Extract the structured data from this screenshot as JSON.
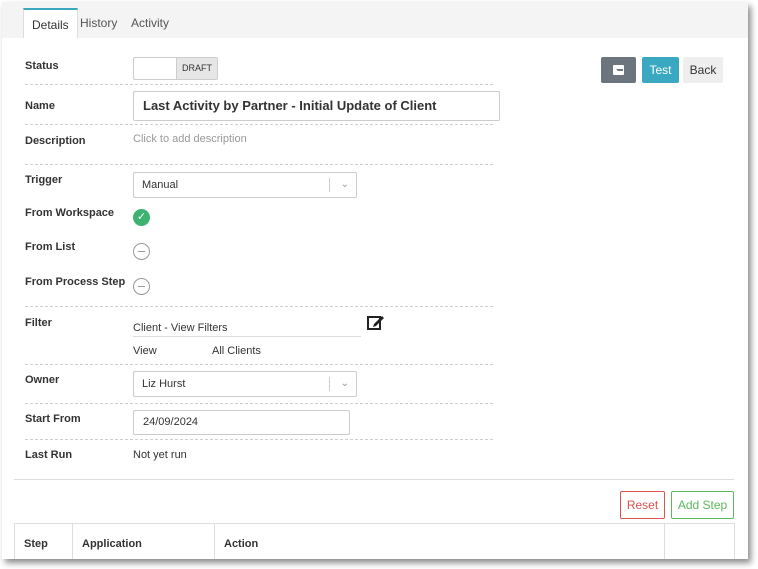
{
  "tabs": [
    "Details",
    "History",
    "Activity"
  ],
  "fields": {
    "status_label": "Status",
    "status_value": "DRAFT",
    "name_label": "Name",
    "name_value": "Last Activity by Partner - Initial Update of Client",
    "description_label": "Description",
    "description_placeholder": "Click to add description",
    "trigger_label": "Trigger",
    "trigger_value": "Manual",
    "from_workspace_label": "From Workspace",
    "from_list_label": "From List",
    "from_process_step_label": "From Process Step",
    "filter_label": "Filter",
    "filter_name": "Client - View Filters",
    "filter_view_label": "View",
    "filter_view_value": "All Clients",
    "owner_label": "Owner",
    "owner_value": "Liz Hurst",
    "start_from_label": "Start From",
    "start_from_value": "24/09/2024",
    "last_run_label": "Last Run",
    "last_run_value": "Not yet run"
  },
  "toolbar": {
    "test_label": "Test",
    "back_label": "Back",
    "icon": "archive-icon"
  },
  "steps": {
    "reset_label": "Reset",
    "add_step_label": "Add Step",
    "columns": [
      "Step",
      "Application",
      "Action",
      ""
    ]
  },
  "colors": {
    "primary": "#3aa8c1",
    "success": "#5cb85c",
    "danger": "#d9534f",
    "secondary": "#6c757d",
    "check": "#3cb371"
  }
}
